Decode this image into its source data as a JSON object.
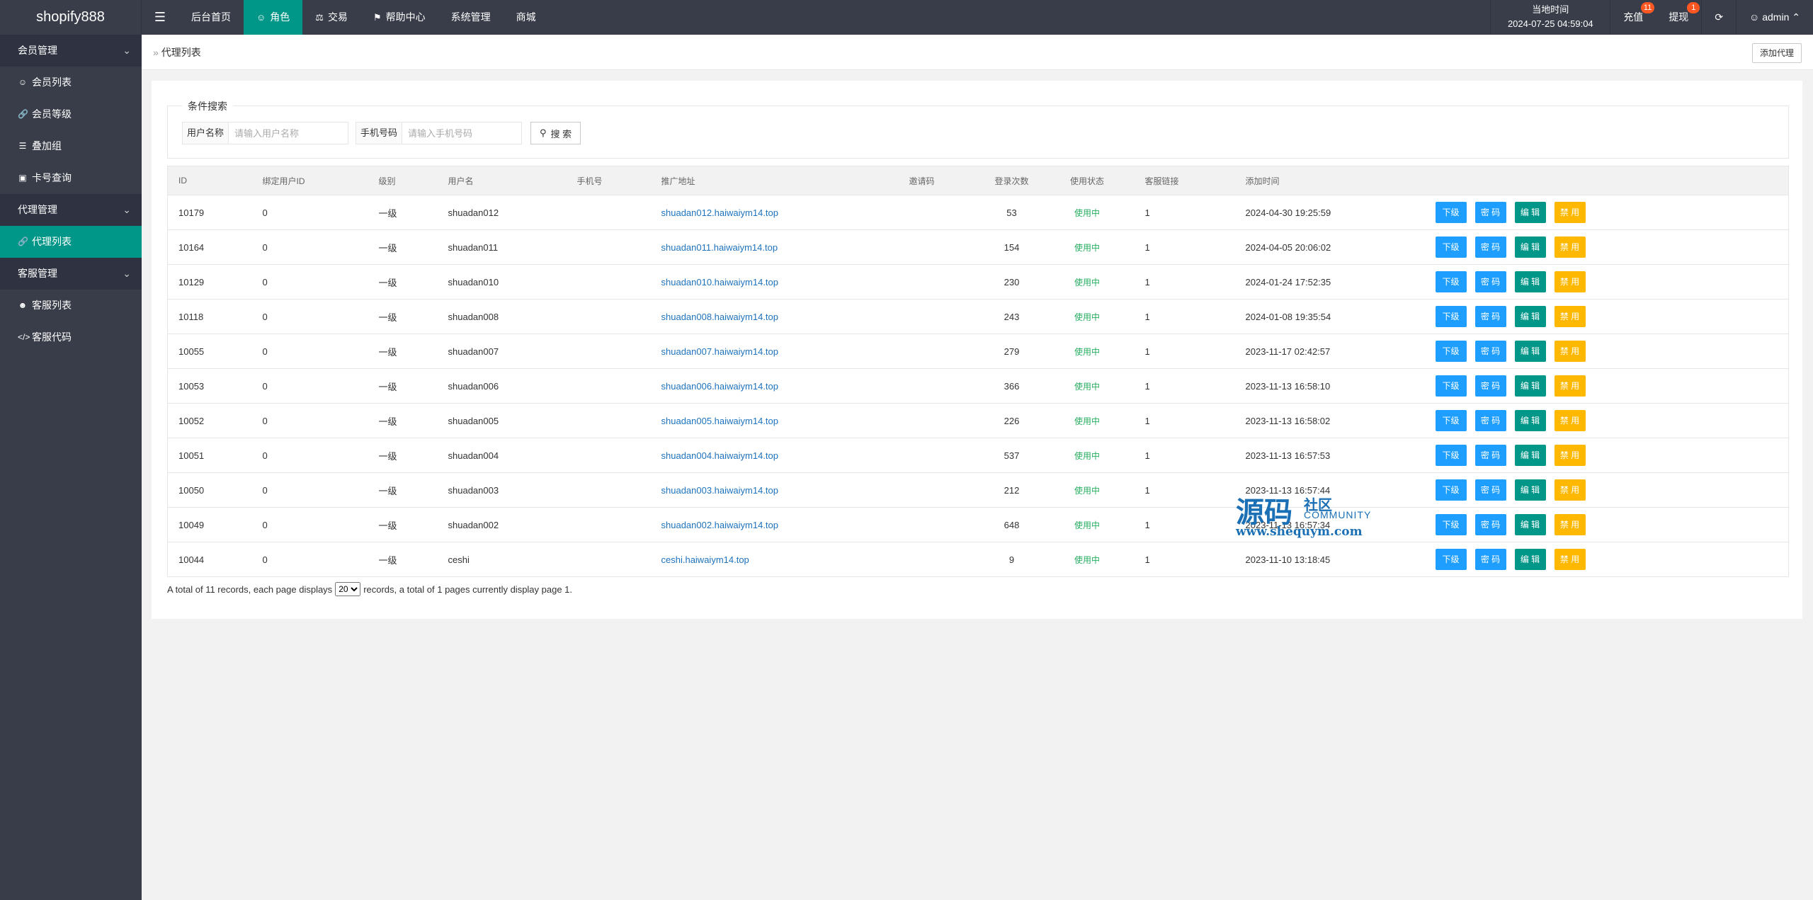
{
  "app": {
    "logo": "shopify888"
  },
  "nav": {
    "items": [
      {
        "label": "后台首页",
        "icon": ""
      },
      {
        "label": "角色",
        "icon": "user-icon"
      },
      {
        "label": "交易",
        "icon": "scale-icon"
      },
      {
        "label": "帮助中心",
        "icon": "flag-icon"
      },
      {
        "label": "系统管理",
        "icon": ""
      },
      {
        "label": "商城",
        "icon": ""
      }
    ],
    "active_index": 1
  },
  "header_right": {
    "clock_label": "当地时间",
    "clock_value": "2024-07-25 04:59:04",
    "recharge_label": "充值",
    "recharge_badge": "11",
    "withdraw_label": "提现",
    "withdraw_badge": "1",
    "user_label": "admin"
  },
  "sidebar": {
    "groups": [
      {
        "label": "会员管理",
        "items": [
          {
            "label": "会员列表",
            "icon": "user-icon"
          },
          {
            "label": "会员等级",
            "icon": "link-icon"
          },
          {
            "label": "叠加组",
            "icon": "list-icon"
          },
          {
            "label": "卡号查询",
            "icon": "card-icon"
          }
        ]
      },
      {
        "label": "代理管理",
        "items": [
          {
            "label": "代理列表",
            "icon": "link-icon"
          }
        ]
      },
      {
        "label": "客服管理",
        "items": [
          {
            "label": "客服列表",
            "icon": "users-icon"
          },
          {
            "label": "客服代码",
            "icon": "code-icon"
          }
        ]
      }
    ]
  },
  "breadcrumb": {
    "current": "代理列表"
  },
  "add_button": "添加代理",
  "search": {
    "legend": "条件搜索",
    "username_label": "用户名称",
    "username_placeholder": "请输入用户名称",
    "phone_label": "手机号码",
    "phone_placeholder": "请输入手机号码",
    "button": "搜 索"
  },
  "table": {
    "headers": [
      "ID",
      "绑定用户ID",
      "级别",
      "用户名",
      "手机号",
      "推广地址",
      "邀请码",
      "登录次数",
      "使用状态",
      "客服链接",
      "添加时间",
      ""
    ],
    "action_labels": [
      "下级",
      "密 码",
      "编 辑",
      "禁 用"
    ],
    "rows": [
      {
        "id": "10179",
        "bind": "0",
        "level": "一级",
        "user": "shuadan012",
        "phone": "",
        "url": "shuadan012.haiwaiym14.top",
        "code": "",
        "logins": "53",
        "status": "使用中",
        "cs": "1",
        "time": "2024-04-30 19:25:59"
      },
      {
        "id": "10164",
        "bind": "0",
        "level": "一级",
        "user": "shuadan011",
        "phone": "",
        "url": "shuadan011.haiwaiym14.top",
        "code": "",
        "logins": "154",
        "status": "使用中",
        "cs": "1",
        "time": "2024-04-05 20:06:02"
      },
      {
        "id": "10129",
        "bind": "0",
        "level": "一级",
        "user": "shuadan010",
        "phone": "",
        "url": "shuadan010.haiwaiym14.top",
        "code": "",
        "logins": "230",
        "status": "使用中",
        "cs": "1",
        "time": "2024-01-24 17:52:35"
      },
      {
        "id": "10118",
        "bind": "0",
        "level": "一级",
        "user": "shuadan008",
        "phone": "",
        "url": "shuadan008.haiwaiym14.top",
        "code": "",
        "logins": "243",
        "status": "使用中",
        "cs": "1",
        "time": "2024-01-08 19:35:54"
      },
      {
        "id": "10055",
        "bind": "0",
        "level": "一级",
        "user": "shuadan007",
        "phone": "",
        "url": "shuadan007.haiwaiym14.top",
        "code": "",
        "logins": "279",
        "status": "使用中",
        "cs": "1",
        "time": "2023-11-17 02:42:57"
      },
      {
        "id": "10053",
        "bind": "0",
        "level": "一级",
        "user": "shuadan006",
        "phone": "",
        "url": "shuadan006.haiwaiym14.top",
        "code": "",
        "logins": "366",
        "status": "使用中",
        "cs": "1",
        "time": "2023-11-13 16:58:10"
      },
      {
        "id": "10052",
        "bind": "0",
        "level": "一级",
        "user": "shuadan005",
        "phone": "",
        "url": "shuadan005.haiwaiym14.top",
        "code": "",
        "logins": "226",
        "status": "使用中",
        "cs": "1",
        "time": "2023-11-13 16:58:02"
      },
      {
        "id": "10051",
        "bind": "0",
        "level": "一级",
        "user": "shuadan004",
        "phone": "",
        "url": "shuadan004.haiwaiym14.top",
        "code": "",
        "logins": "537",
        "status": "使用中",
        "cs": "1",
        "time": "2023-11-13 16:57:53"
      },
      {
        "id": "10050",
        "bind": "0",
        "level": "一级",
        "user": "shuadan003",
        "phone": "",
        "url": "shuadan003.haiwaiym14.top",
        "code": "",
        "logins": "212",
        "status": "使用中",
        "cs": "1",
        "time": "2023-11-13 16:57:44"
      },
      {
        "id": "10049",
        "bind": "0",
        "level": "一级",
        "user": "shuadan002",
        "phone": "",
        "url": "shuadan002.haiwaiym14.top",
        "code": "",
        "logins": "648",
        "status": "使用中",
        "cs": "1",
        "time": "2023-11-13 16:57:34"
      },
      {
        "id": "10044",
        "bind": "0",
        "level": "一级",
        "user": "ceshi",
        "phone": "",
        "url": "ceshi.haiwaiym14.top",
        "code": "",
        "logins": "9",
        "status": "使用中",
        "cs": "1",
        "time": "2023-11-10 13:18:45"
      }
    ]
  },
  "pager": {
    "before": "A total of 11 records, each page displays",
    "page_size": "20",
    "after": "records, a total of 1 pages currently display page 1."
  },
  "watermark": {
    "big": "源码",
    "small": "社区",
    "comm": "COMMUNITY",
    "url": "www.shequym.com"
  },
  "colors": {
    "topbar": "#393d49",
    "active": "#009688",
    "btn_blue": "#1e9fff",
    "btn_green": "#009688",
    "btn_orange": "#ffb800",
    "badge": "#ff5722"
  }
}
